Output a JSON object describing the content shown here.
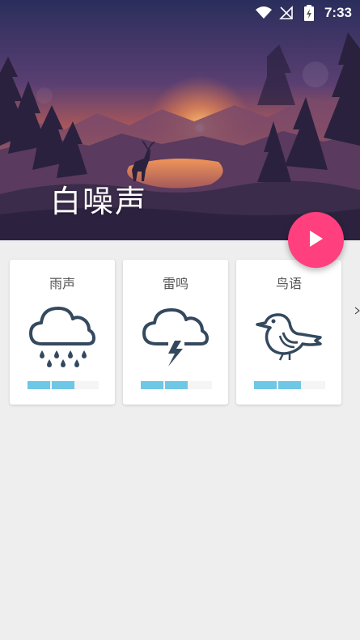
{
  "status_bar": {
    "time": "7:33",
    "icons": [
      "wifi-icon",
      "no-signal-icon",
      "battery-charging-icon"
    ]
  },
  "header": {
    "title": "白噪声"
  },
  "fab": {
    "icon": "play-icon",
    "color": "#ff3f7e"
  },
  "sounds": [
    {
      "label": "雨声",
      "icon": "rain-cloud-icon",
      "volume_segments": 2
    },
    {
      "label": "雷鸣",
      "icon": "thunder-cloud-icon",
      "volume_segments": 2
    },
    {
      "label": "鸟语",
      "icon": "bird-icon",
      "volume_segments": 2
    }
  ],
  "colors": {
    "accent": "#ff3f7e",
    "volume_bar": "#6fc7e6",
    "icon_stroke": "#34495e",
    "background": "#eeeeee"
  }
}
